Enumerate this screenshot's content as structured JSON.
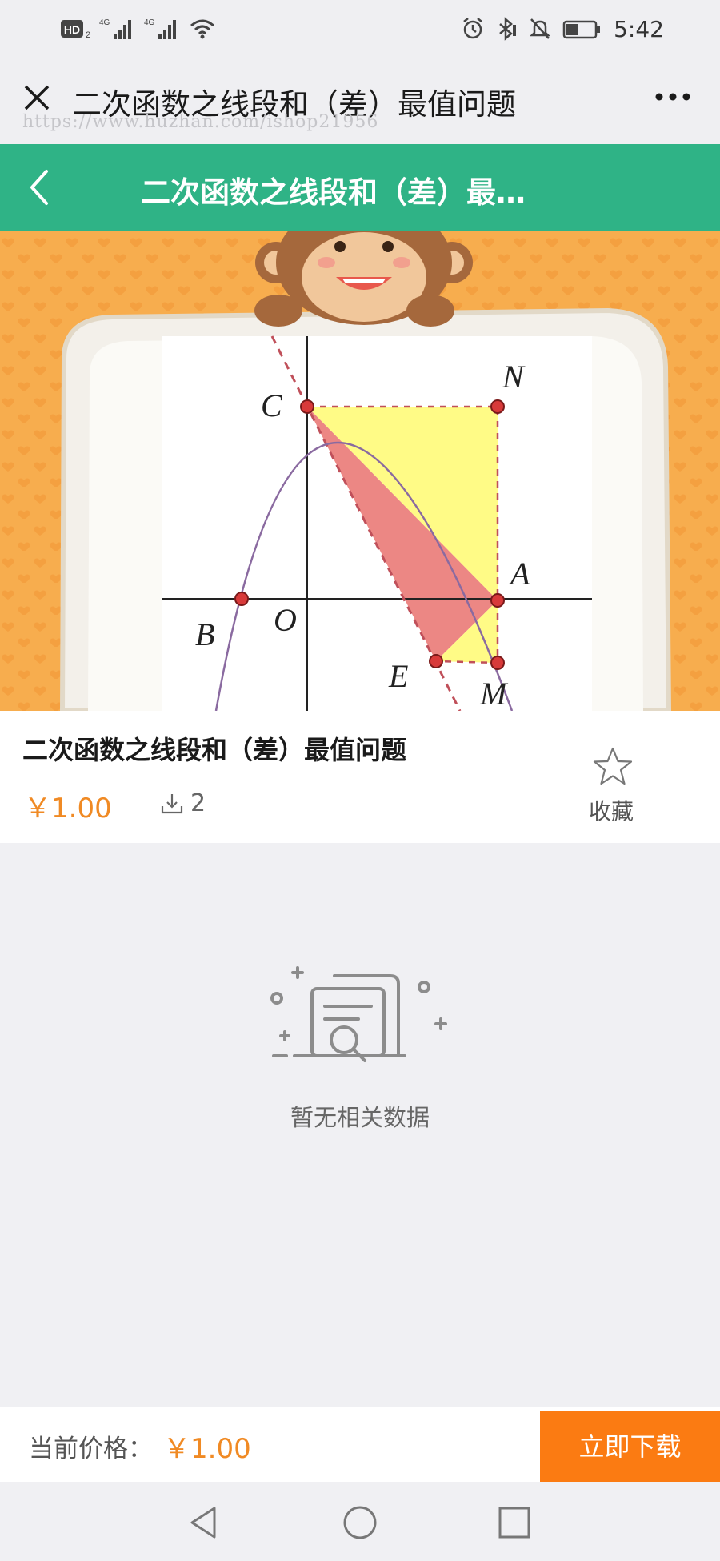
{
  "status_bar": {
    "network_hd": "HD",
    "network_1": "4G",
    "network_2": "4G",
    "time": "5:42"
  },
  "title_bar": {
    "title": "二次函数之线段和（差）最值问题",
    "watermark": "https://www.huzhan.com/ishop21956"
  },
  "header": {
    "title": "二次函数之线段和（差）最…"
  },
  "banner": {
    "point_labels": [
      "C",
      "N",
      "A",
      "B",
      "O",
      "E",
      "M"
    ]
  },
  "product": {
    "title": "二次函数之线段和（差）最值问题",
    "price": "￥1.00",
    "downloads": "2",
    "favorite_label": "收藏"
  },
  "empty_state": {
    "text": "暂无相关数据"
  },
  "bottom_bar": {
    "price_label": "当前价格：",
    "price_value": "￥1.00",
    "buy_label": "立即下载",
    "accent_color": "#fb7b12"
  },
  "colors": {
    "header_green": "#2fb386",
    "price_orange": "#f08a24"
  }
}
